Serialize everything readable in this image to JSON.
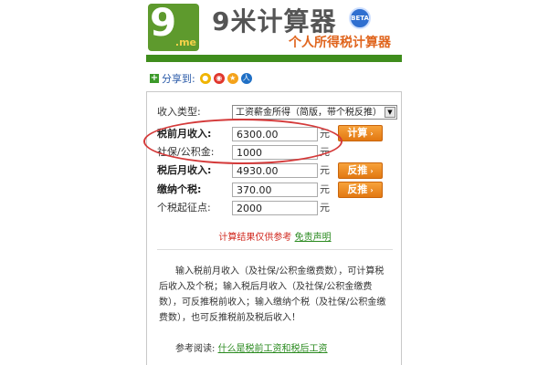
{
  "header": {
    "logo_main": "9米",
    "logo_sub": ".me",
    "title": "9米计算器",
    "beta": "BETA",
    "subtitle": "个人所得税计算器"
  },
  "share": {
    "label": "分享到:",
    "icons": [
      "qq-icon",
      "weibo-icon",
      "qzone-icon",
      "renren-icon"
    ]
  },
  "form": {
    "income_type_label": "收入类型:",
    "income_type_value": "工资薪金所得（简版，带个税反推）",
    "pre_tax_label": "税前月收入:",
    "pre_tax_value": "6300.00",
    "social_label": "社保/公积金:",
    "social_value": "1000",
    "after_tax_label": "税后月收入:",
    "after_tax_value": "4930.00",
    "tax_label": "缴纳个税:",
    "tax_value": "370.00",
    "threshold_label": "个税起征点:",
    "threshold_value": "2000",
    "unit": "元",
    "calc_button": "计算",
    "reverse_button": "反推",
    "chevron": "›"
  },
  "note": {
    "text": "计算结果仅供参考",
    "link": "免责声明"
  },
  "description": "输入税前月收入（及社保/公积金缴费数），可计算税后收入及个税；输入税后月收入（及社保/公积金缴费数），可反推税前收入；输入缴纳个税（及社保/公积金缴费数），也可反推税前及税后收入！",
  "reference": {
    "label": "参考阅读:",
    "link": "什么是税前工资和税后工资"
  },
  "colors": {
    "brand_green": "#3f8d1c",
    "accent_orange": "#e27812",
    "highlight_red": "#d43a3a"
  }
}
